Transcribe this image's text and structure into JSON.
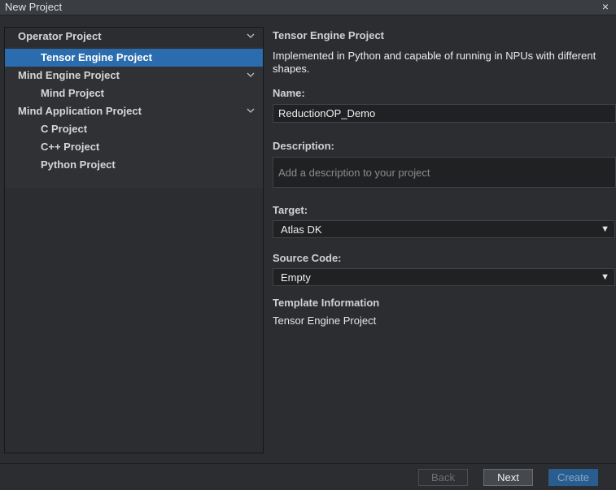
{
  "window": {
    "title": "New Project",
    "close_glyph": "×"
  },
  "tree": {
    "items": [
      {
        "label": "Operator Project",
        "type": "group"
      },
      {
        "label": "Tensor Engine Project",
        "type": "child",
        "selected": true
      },
      {
        "label": "Mind Engine Project",
        "type": "group"
      },
      {
        "label": "Mind Project",
        "type": "child"
      },
      {
        "label": "Mind Application Project",
        "type": "group"
      },
      {
        "label": "C Project",
        "type": "child"
      },
      {
        "label": "C++ Project",
        "type": "child"
      },
      {
        "label": "Python Project",
        "type": "child"
      }
    ]
  },
  "details": {
    "heading": "Tensor Engine Project",
    "description": "Implemented in Python and capable of running in NPUs with different shapes.",
    "name_label": "Name:",
    "name_value": "ReductionOP_Demo",
    "description_label": "Description:",
    "description_placeholder": "Add a description to your project",
    "target_label": "Target:",
    "target_value": "Atlas DK",
    "source_label": "Source Code:",
    "source_value": "Empty",
    "template_label": "Template Information",
    "template_value": "Tensor Engine Project",
    "dropdown_glyph": "▼"
  },
  "footer": {
    "back": "Back",
    "next": "Next",
    "create": "Create"
  },
  "colors": {
    "selection": "#2a6cad",
    "background": "#2b2d30",
    "create_button": "#2a5d8f"
  }
}
